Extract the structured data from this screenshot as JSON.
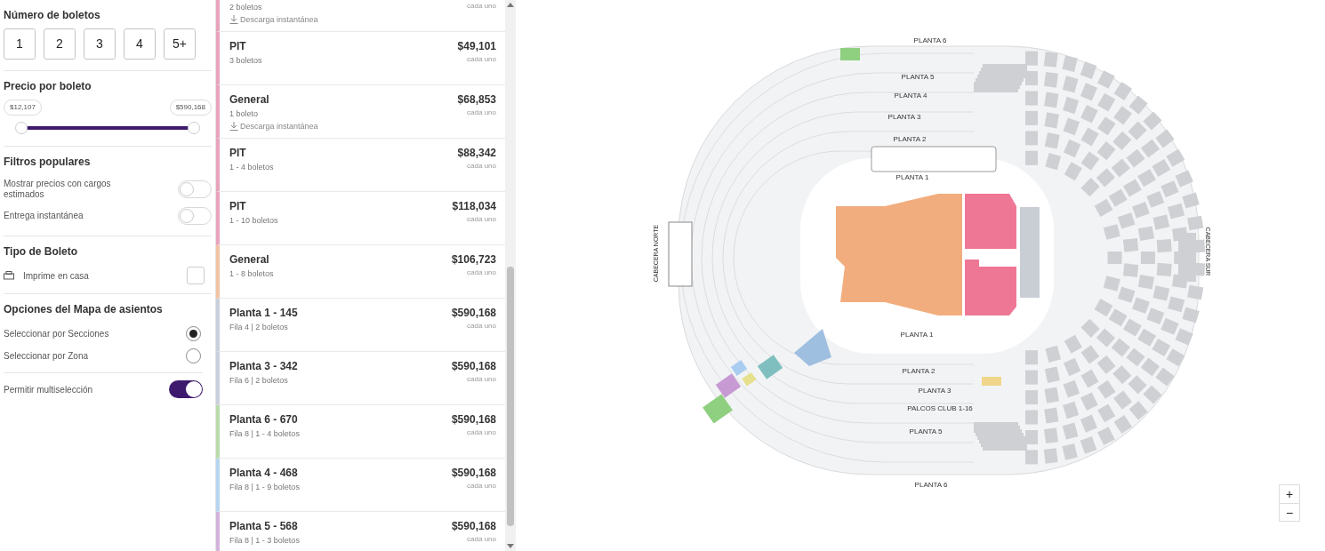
{
  "filters": {
    "ticket_count": {
      "title": "Número de boletos",
      "options": [
        "1",
        "2",
        "3",
        "4",
        "5+"
      ]
    },
    "price": {
      "title": "Precio por boleto",
      "min_label": "$12,107",
      "max_label": "$590,168",
      "low": {
        "level": 0
      },
      "high": {
        "level": 1
      }
    },
    "popular": {
      "title": "Filtros populares",
      "toggles": [
        {
          "label": "Mostrar precios con cargos estimados",
          "on": false
        },
        {
          "label": "Entrega instantánea",
          "on": false
        }
      ]
    },
    "ticket_type": {
      "title": "Tipo de Boleto",
      "options": [
        {
          "label": "Imprime en casa",
          "checked": false
        }
      ]
    },
    "map_options": {
      "title": "Opciones del Mapa de asientos",
      "radios": [
        {
          "label": "Seleccionar por Secciones",
          "selected": true
        },
        {
          "label": "Seleccionar por Zona",
          "selected": false
        }
      ],
      "toggles": [
        {
          "label": "Permitir multiselección",
          "on": true
        }
      ]
    }
  },
  "listings": [
    {
      "kind": "partial",
      "subtitle": "2 boletos",
      "feature": "Descarga instantánea",
      "note": "cada uno",
      "color": "#e9a3bd"
    },
    {
      "kind": "full",
      "title": "PIT",
      "subtitle": "3 boletos",
      "price": "$49,101",
      "note": "cada uno",
      "color": "#e9a3bd"
    },
    {
      "kind": "full",
      "title": "General",
      "subtitle": "1 boleto",
      "feature": "Descarga instantánea",
      "price": "$68,853",
      "note": "cada uno",
      "color": "#e9a3bd"
    },
    {
      "kind": "full",
      "title": "PIT",
      "subtitle": "1 - 4 boletos",
      "price": "$88,342",
      "note": "cada uno",
      "color": "#e9a3bd"
    },
    {
      "kind": "full",
      "title": "PIT",
      "subtitle": "1 - 10 boletos",
      "price": "$118,034",
      "note": "cada uno",
      "color": "#e9a3bd"
    },
    {
      "kind": "full",
      "title": "General",
      "subtitle": "1 - 8 boletos",
      "price": "$106,723",
      "note": "cada uno",
      "color": "#f2c3a4"
    },
    {
      "kind": "full",
      "title": "Planta 1 - 145",
      "subtitle": "Fila 4 | 2 boletos",
      "price": "$590,168",
      "note": "cada uno",
      "color": "#c9cfdc"
    },
    {
      "kind": "full",
      "title": "Planta 3 - 342",
      "subtitle": "Fila 6 | 2 boletos",
      "price": "$590,168",
      "note": "cada uno",
      "color": "#c9cfdc"
    },
    {
      "kind": "full",
      "title": "Planta 6 - 670",
      "subtitle": "Fila 8 | 1 - 4 boletos",
      "price": "$590,168",
      "note": "cada uno",
      "color": "#b9dcab"
    },
    {
      "kind": "full",
      "title": "Planta 4 - 468",
      "subtitle": "Fila 8 | 1 - 9 boletos",
      "price": "$590,168",
      "note": "cada uno",
      "color": "#b8d5f0"
    },
    {
      "kind": "full",
      "title": "Planta 5 - 568",
      "subtitle": "Fila 8 | 1 - 3 boletos",
      "price": "$590,168",
      "note": "cada uno",
      "color": "#d3b3da"
    }
  ],
  "map": {
    "labels": [
      {
        "text": "PLANTA 6",
        "kind": "level"
      },
      {
        "text": "PLANTA 5",
        "kind": "level"
      },
      {
        "text": "PLANTA 4",
        "kind": "level"
      },
      {
        "text": "PLANTA 3",
        "kind": "level"
      },
      {
        "text": "PLANTA 2",
        "kind": "level"
      },
      {
        "text": "PLANTA 1",
        "kind": "level"
      },
      {
        "text": "PLANTA 1",
        "kind": "level"
      },
      {
        "text": "PLANTA 2",
        "kind": "level"
      },
      {
        "text": "PLANTA 3",
        "kind": "level"
      },
      {
        "text": "PALCOS CLUB 1-16",
        "kind": "level"
      },
      {
        "text": "PLANTA 5",
        "kind": "level"
      },
      {
        "text": "PLANTA 6",
        "kind": "level"
      },
      {
        "text": "CABECERA NORTE",
        "kind": "end_left"
      },
      {
        "text": "CABECERA SUR",
        "kind": "end_right"
      }
    ],
    "zoom": [
      "+",
      "−"
    ]
  }
}
